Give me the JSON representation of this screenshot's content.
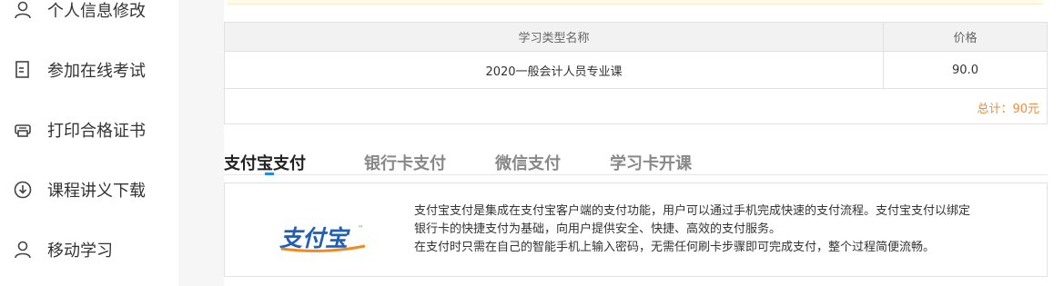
{
  "sidebar": {
    "items": [
      {
        "label": "个人信息修改",
        "icon": "user-icon"
      },
      {
        "label": "参加在线考试",
        "icon": "exam-doc-icon"
      },
      {
        "label": "打印合格证书",
        "icon": "printer-icon"
      },
      {
        "label": "课程讲义下载",
        "icon": "download-icon"
      },
      {
        "label": "移动学习",
        "icon": "user-icon"
      }
    ]
  },
  "order_table": {
    "headers": {
      "name": "学习类型名称",
      "price": "价格"
    },
    "rows": [
      {
        "name": "2020一般会计人员专业课",
        "price": "90.0"
      }
    ],
    "total": "总计：90元"
  },
  "payment": {
    "tabs": [
      {
        "label": "支付宝支付",
        "active": true
      },
      {
        "label": "银行卡支付",
        "active": false
      },
      {
        "label": "微信支付",
        "active": false
      },
      {
        "label": "学习卡开课",
        "active": false
      }
    ],
    "logo_text": "支付宝",
    "logo_tm": "™",
    "description": [
      "支付宝支付是集成在支付宝客户端的支付功能，用户可以通过手机完成快速的支付流程。支付宝支付以绑定",
      "银行卡的快捷支付为基础，向用户提供安全、快捷、高效的支付服务。",
      "在支付时只需在自己的智能手机上输入密码，无需任何刷卡步骤即可完成支付，整个过程简便流畅。"
    ]
  },
  "colors": {
    "total": "#f08c3c",
    "tab_active": "#222222",
    "tab_inactive": "#888888",
    "logo_blue": "#1f5fb8",
    "logo_orange": "#f08a1d",
    "underline": "#2b8ad8"
  }
}
